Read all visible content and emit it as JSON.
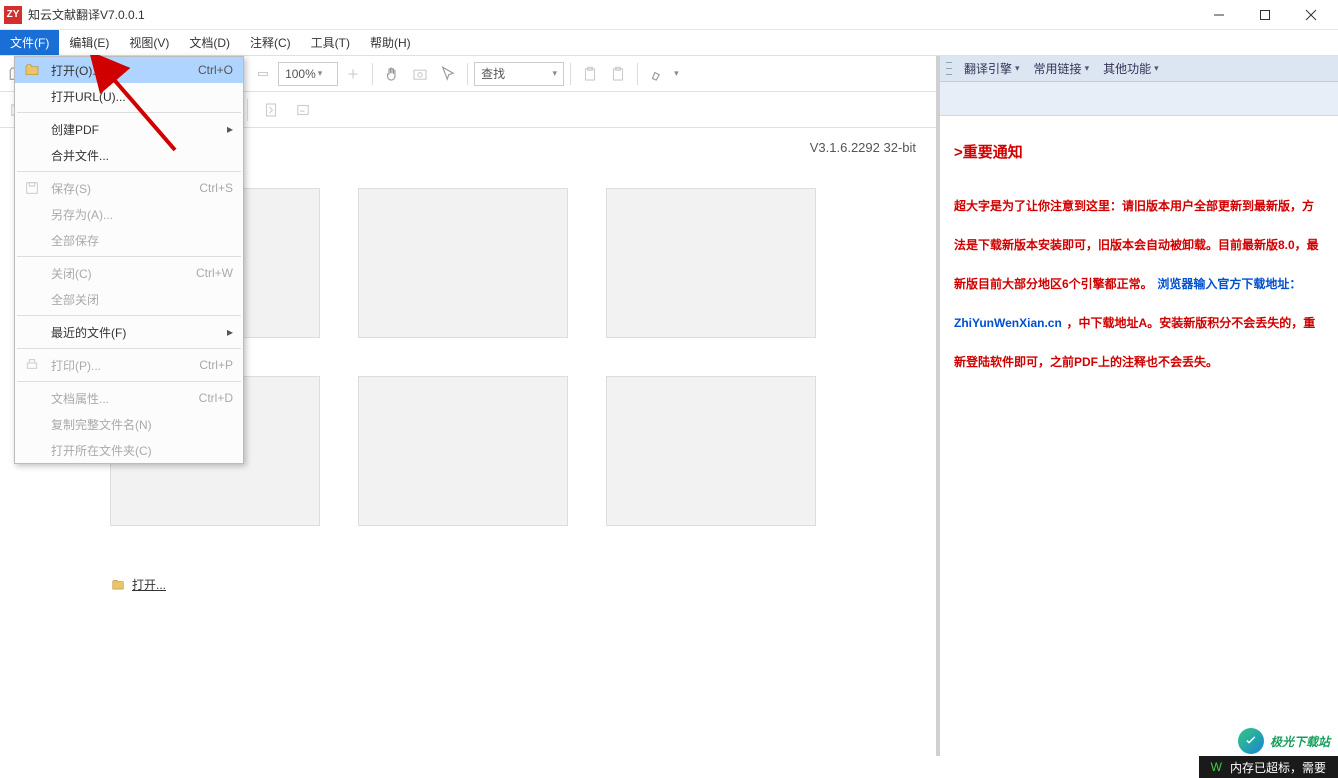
{
  "app": {
    "icon_text": "ZY",
    "title": "知云文献翻译V7.0.0.1"
  },
  "menubar": [
    {
      "label": "文件(F)",
      "active": true
    },
    {
      "label": "编辑(E)"
    },
    {
      "label": "视图(V)"
    },
    {
      "label": "文档(D)"
    },
    {
      "label": "注释(C)"
    },
    {
      "label": "工具(T)"
    },
    {
      "label": "帮助(H)"
    }
  ],
  "toolbar": {
    "zoom": "100%",
    "search": "查找"
  },
  "version": "V3.1.6.2292 32-bit",
  "open_link": "打开...",
  "dropdown": [
    {
      "type": "item",
      "label": "打开(O)...",
      "shortcut": "Ctrl+O",
      "icon": "folder",
      "highlighted": true
    },
    {
      "type": "item",
      "label": "打开URL(U)..."
    },
    {
      "type": "sep"
    },
    {
      "type": "item",
      "label": "创建PDF",
      "submenu": true
    },
    {
      "type": "item",
      "label": "合并文件..."
    },
    {
      "type": "sep"
    },
    {
      "type": "item",
      "label": "保存(S)",
      "shortcut": "Ctrl+S",
      "icon": "save",
      "disabled": true
    },
    {
      "type": "item",
      "label": "另存为(A)...",
      "disabled": true
    },
    {
      "type": "item",
      "label": "全部保存",
      "disabled": true
    },
    {
      "type": "sep"
    },
    {
      "type": "item",
      "label": "关闭(C)",
      "shortcut": "Ctrl+W",
      "disabled": true
    },
    {
      "type": "item",
      "label": "全部关闭",
      "disabled": true
    },
    {
      "type": "sep"
    },
    {
      "type": "item",
      "label": "最近的文件(F)",
      "submenu": true
    },
    {
      "type": "sep"
    },
    {
      "type": "item",
      "label": "打印(P)...",
      "shortcut": "Ctrl+P",
      "icon": "print",
      "disabled": true
    },
    {
      "type": "sep"
    },
    {
      "type": "item",
      "label": "文档属性...",
      "shortcut": "Ctrl+D",
      "disabled": true
    },
    {
      "type": "item",
      "label": "复制完整文件名(N)",
      "disabled": true
    },
    {
      "type": "item",
      "label": "打开所在文件夹(C)",
      "disabled": true
    }
  ],
  "right_toolbar": [
    {
      "label": "翻译引擎"
    },
    {
      "label": "常用链接"
    },
    {
      "label": "其他功能"
    }
  ],
  "notice": {
    "title": ">重要通知",
    "p1": "超大字是为了让你注意到这里：请旧版本用户全部更新到最新版，方法是下载新版本安装即可，旧版本会自动被卸载。目前最新版8.0，最新版目前大部分地区6个引擎都正常。",
    "p2a": "浏览器输入官方下载地址：",
    "p2b": "ZhiYunWenXian.cn",
    "p3": "，中下载地址A。安装新版积分不会丢失的，重新登陆软件即可，之前PDF上的注释也不会丢失。"
  },
  "statusbar": {
    "text": "内存已超标，需要"
  },
  "watermark": {
    "text": "极光下载站"
  }
}
